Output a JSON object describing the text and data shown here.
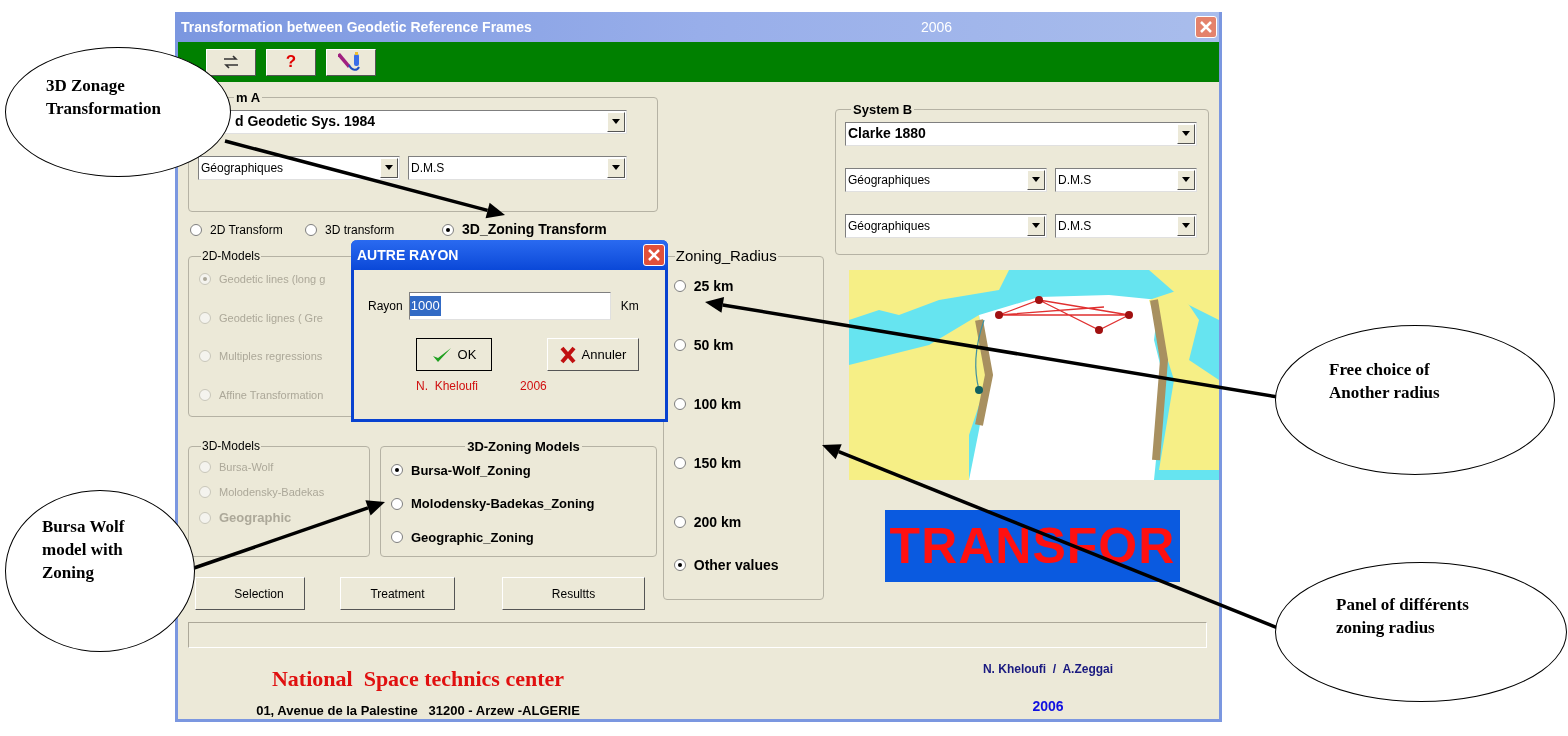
{
  "window": {
    "title": "Transformation between Geodetic Reference Frames",
    "year": "2006"
  },
  "toolbar": {
    "buttons": [
      {
        "kind": "swap"
      },
      {
        "kind": "help",
        "label": "?"
      },
      {
        "kind": "pen"
      }
    ]
  },
  "system_a": {
    "label": "m A",
    "datum": "d Geodetic Sys. 1984",
    "rows": [
      {
        "coord_type": "Géographiques",
        "format": "D.M.S"
      }
    ]
  },
  "transform_options": [
    {
      "label": "2D Transform",
      "selected": false
    },
    {
      "label": "3D transform",
      "selected": false
    },
    {
      "label": "3D_Zoning Transform",
      "selected": true
    }
  ],
  "models_2d": {
    "title": "2D-Models",
    "items": [
      {
        "label": "Geodetic lines (long g",
        "selected": true,
        "disabled": true
      },
      {
        "label": "Geodetic lignes ( Gre",
        "selected": false,
        "disabled": true
      },
      {
        "label": "Multiples regressions",
        "selected": false,
        "disabled": true
      },
      {
        "label": "Affine Transformation",
        "selected": false,
        "disabled": true
      }
    ]
  },
  "models_3d": {
    "title": "3D-Models",
    "items": [
      {
        "label": "Bursa-Wolf",
        "selected": false,
        "disabled": true
      },
      {
        "label": "Molodensky-Badekas",
        "selected": false,
        "disabled": true
      },
      {
        "label": "Geographic",
        "selected": false,
        "disabled": true
      }
    ]
  },
  "zoning_models": {
    "title": "3D-Zoning Models",
    "items": [
      {
        "label": "Bursa-Wolf_Zoning",
        "selected": true,
        "disabled": false
      },
      {
        "label": "Molodensky-Badekas_Zoning",
        "selected": false,
        "disabled": false
      },
      {
        "label": "Geographic_Zoning",
        "selected": false,
        "disabled": false
      }
    ]
  },
  "actions": [
    "Selection",
    "Treatment",
    "Resultts"
  ],
  "zoning_radius": {
    "title": "Zoning_Radius",
    "items": [
      {
        "label": "25 km",
        "selected": false
      },
      {
        "label": "50 km",
        "selected": false
      },
      {
        "label": "100 km",
        "selected": false
      },
      {
        "label": "150 km",
        "selected": false
      },
      {
        "label": "200 km",
        "selected": false
      },
      {
        "label": "Other values",
        "selected": true
      }
    ]
  },
  "system_b": {
    "label": "System  B",
    "datum": "Clarke 1880",
    "rows": [
      {
        "coord_type": "Géographiques",
        "format": "D.M.S"
      },
      {
        "coord_type": "Géographiques",
        "format": "D.M.S"
      }
    ]
  },
  "map": {
    "kind": "picture"
  },
  "banner": "TRANSFOR",
  "footer": {
    "organization": "National  Space technics center",
    "address": "01, Avenue de la Palestine   31200 - Arzew -ALGERIE",
    "authors": "N. Kheloufi  /  A.Zeggai",
    "year": "2006"
  },
  "dialog": {
    "title": "AUTRE RAYON",
    "field_label": "Rayon",
    "value": "1000",
    "unit": "Km",
    "buttons": [
      {
        "kind": "ok",
        "label": "OK"
      },
      {
        "kind": "cancel",
        "label": "Annuler"
      }
    ],
    "credit_name": "N.  Kheloufi",
    "credit_year": "2006"
  },
  "callouts": [
    {
      "lines": [
        "3D Zonage",
        "Transformation"
      ]
    },
    {
      "lines": [
        "Bursa Wolf",
        "model with",
        "Zoning"
      ]
    },
    {
      "lines": [
        "Free choice of",
        "Another radius"
      ]
    },
    {
      "lines": [
        "Panel of différents",
        "zoning radius"
      ]
    }
  ]
}
